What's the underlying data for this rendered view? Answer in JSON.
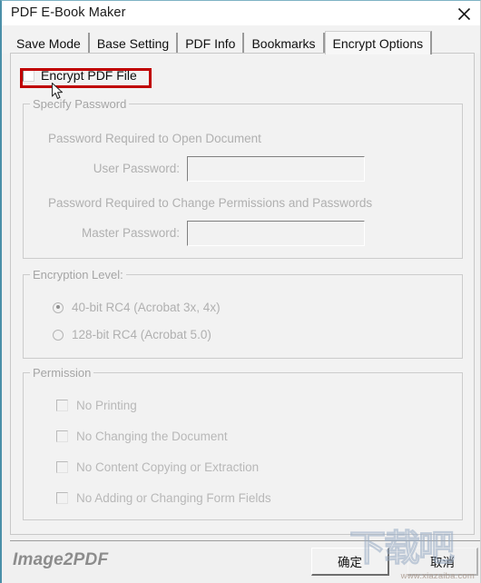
{
  "window": {
    "title": "PDF E-Book Maker",
    "close_icon": "close-icon"
  },
  "tabs": [
    {
      "label": "Save Mode",
      "active": false
    },
    {
      "label": "Base Setting",
      "active": false
    },
    {
      "label": "PDF Info",
      "active": false
    },
    {
      "label": "Bookmarks",
      "active": false
    },
    {
      "label": "Encrypt Options",
      "active": true
    }
  ],
  "encrypt": {
    "enable_label": "Encrypt PDF File",
    "enable_checked": false,
    "highlight_color": "#c00000"
  },
  "specify_password": {
    "group_title": "Specify Password",
    "open_doc_label": "Password Required to Open Document",
    "user_password_label": "User Password:",
    "user_password_value": "",
    "change_perm_label": "Password Required to Change Permissions and Passwords",
    "master_password_label": "Master Password:",
    "master_password_value": ""
  },
  "encryption_level": {
    "group_title": "Encryption Level:",
    "options": [
      {
        "label": "40-bit RC4 (Acrobat 3x, 4x)",
        "selected": true
      },
      {
        "label": "128-bit RC4 (Acrobat 5.0)",
        "selected": false
      }
    ]
  },
  "permission": {
    "group_title": "Permission",
    "items": [
      {
        "label": "No Printing",
        "checked": false
      },
      {
        "label": "No Changing the Document",
        "checked": false
      },
      {
        "label": "No Content Copying or Extraction",
        "checked": false
      },
      {
        "label": "No Adding or Changing Form Fields",
        "checked": false
      }
    ]
  },
  "footer": {
    "brand": "Image2PDF",
    "ok_label": "确定",
    "cancel_label": "取消"
  },
  "watermark": {
    "glyphs": "下载吧",
    "url": "www.xiazaiba.com"
  }
}
